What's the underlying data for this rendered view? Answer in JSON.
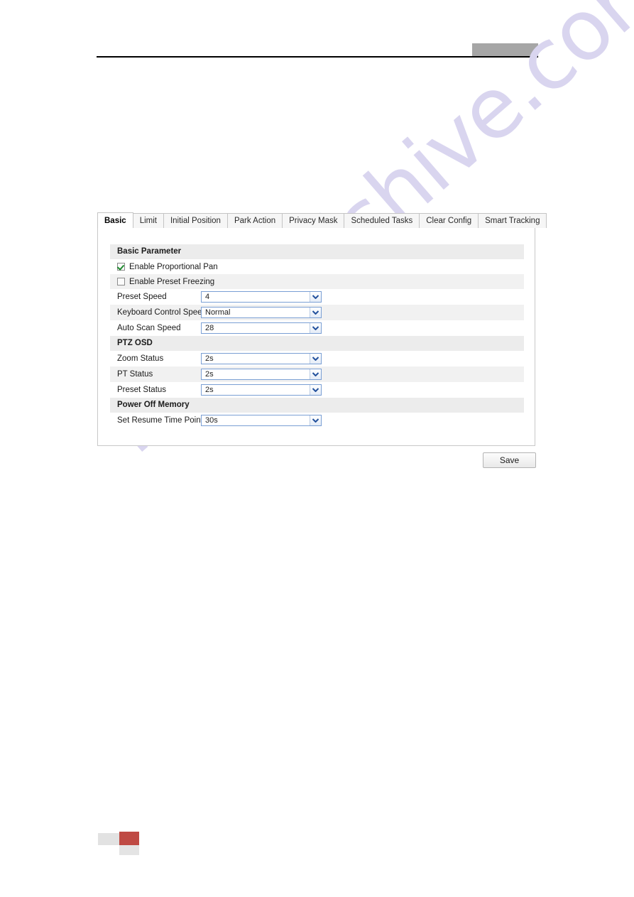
{
  "header": {
    "redaction_color": "#a6a6a6",
    "rule_color": "#000000"
  },
  "watermark": {
    "text": "manualshive.com",
    "color": "#d9d5ef"
  },
  "tabs": [
    {
      "label": "Basic",
      "active": true
    },
    {
      "label": "Limit",
      "active": false
    },
    {
      "label": "Initial Position",
      "active": false
    },
    {
      "label": "Park Action",
      "active": false
    },
    {
      "label": "Privacy Mask",
      "active": false
    },
    {
      "label": "Scheduled Tasks",
      "active": false
    },
    {
      "label": "Clear Config",
      "active": false
    },
    {
      "label": "Smart Tracking",
      "active": false
    }
  ],
  "sections": {
    "basic_parameter": {
      "title": "Basic Parameter",
      "checkboxes": [
        {
          "label": "Enable Proportional Pan",
          "checked": true
        },
        {
          "label": "Enable Preset Freezing",
          "checked": false
        }
      ],
      "fields": [
        {
          "label": "Preset Speed",
          "value": "4"
        },
        {
          "label": "Keyboard Control Speed",
          "value": "Normal"
        },
        {
          "label": "Auto Scan Speed",
          "value": "28"
        }
      ]
    },
    "ptz_osd": {
      "title": "PTZ OSD",
      "fields": [
        {
          "label": "Zoom Status",
          "value": "2s"
        },
        {
          "label": "PT Status",
          "value": "2s"
        },
        {
          "label": "Preset Status",
          "value": "2s"
        }
      ]
    },
    "power_off_memory": {
      "title": "Power Off Memory",
      "fields": [
        {
          "label": "Set Resume Time Point",
          "value": "30s"
        }
      ]
    }
  },
  "buttons": {
    "save": "Save"
  },
  "footer_logo": {
    "accent_color": "#bf4a44",
    "neutral_color": "#e2e2e2"
  }
}
